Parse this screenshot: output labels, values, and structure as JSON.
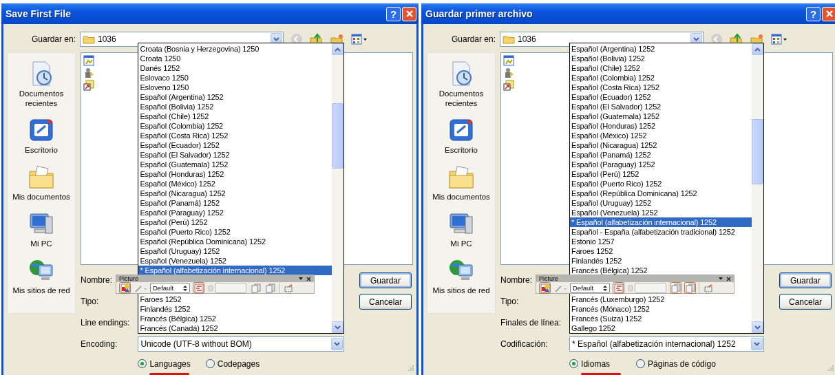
{
  "dialogs": [
    {
      "title": "Save First File",
      "help_button": "?",
      "save_in": {
        "label": "Guardar en:",
        "value": "1036"
      },
      "places": [
        {
          "label": "Documentos recientes",
          "kind": "recent"
        },
        {
          "label": "Escritorio",
          "kind": "desktop"
        },
        {
          "label": "Mis documentos",
          "kind": "documents"
        },
        {
          "label": "Mi PC",
          "kind": "computer"
        },
        {
          "label": "Mis sitios de red",
          "kind": "network"
        }
      ],
      "files": [
        {
          "kind": "image"
        },
        {
          "kind": "program"
        },
        {
          "kind": "shortcut"
        }
      ],
      "fields": [
        {
          "label": "Nombre:",
          "kind": "text"
        },
        {
          "label": "Tipo:",
          "kind": "text"
        },
        {
          "label": "Line endings:",
          "kind": "none"
        },
        {
          "label": "Encoding:",
          "kind": "combo",
          "value": "Unicode (UTF-8 without BOM)"
        }
      ],
      "dropdown": {
        "items_above": [
          {
            "text": "Croata (Bosnia y Herzegovina) 1250",
            "selected": false
          },
          {
            "text": "Croata 1250",
            "selected": false
          },
          {
            "text": "Danés 1252",
            "selected": false
          },
          {
            "text": "Eslovaco 1250",
            "selected": false
          },
          {
            "text": "Esloveno 1250",
            "selected": false
          },
          {
            "text": "Español (Argentina) 1252",
            "selected": false
          },
          {
            "text": "Español (Bolivia) 1252",
            "selected": false
          },
          {
            "text": "Español (Chile) 1252",
            "selected": false
          },
          {
            "text": "Español (Colombia) 1252",
            "selected": false
          },
          {
            "text": "Español (Costa Rica) 1252",
            "selected": false
          },
          {
            "text": "Español (Ecuador) 1252",
            "selected": false
          },
          {
            "text": "Español (El Salvador) 1252",
            "selected": false
          },
          {
            "text": "Español (Guatemala) 1252",
            "selected": false
          },
          {
            "text": "Español (Honduras) 1252",
            "selected": false
          },
          {
            "text": "Español (México) 1252",
            "selected": false
          },
          {
            "text": "Español (Nicaragua) 1252",
            "selected": false
          },
          {
            "text": "Español (Panamá) 1252",
            "selected": false
          },
          {
            "text": "Español (Paraguay) 1252",
            "selected": false
          },
          {
            "text": "Español (Perú) 1252",
            "selected": false
          },
          {
            "text": "Español (Puerto Rico) 1252",
            "selected": false
          },
          {
            "text": "Español (República Dominicana) 1252",
            "selected": false
          },
          {
            "text": "Español (Uruguay) 1252",
            "selected": false
          },
          {
            "text": "Español (Venezuela) 1252",
            "selected": false
          },
          {
            "text": "* Español (alfabetización internacional) 1252",
            "selected": true
          }
        ],
        "items_below": [
          {
            "text": "Faroes 1252",
            "selected": false
          },
          {
            "text": "Finlandés 1252",
            "selected": false
          },
          {
            "text": "Francés (Bélgica) 1252",
            "selected": false
          },
          {
            "text": "Francés (Canadá) 1252",
            "selected": false
          }
        ]
      },
      "buttons": [
        {
          "label": "Guardar",
          "default": true
        },
        {
          "label": "Cancelar",
          "default": false
        }
      ],
      "radios": [
        {
          "label": "Languages",
          "selected": true,
          "underlined": true
        },
        {
          "label": "Codepages",
          "selected": false,
          "underlined": false
        }
      ],
      "picture_toolbar": {
        "title": "Picture",
        "tools": [
          {
            "kind": "image",
            "on": true
          },
          {
            "kind": "brush",
            "on": false
          },
          {
            "kind": "select",
            "value": "Default"
          },
          {
            "kind": "filter",
            "on": true
          },
          {
            "kind": "spin",
            "on": false
          },
          {
            "kind": "copy",
            "on": false
          },
          {
            "kind": "copy",
            "on": false
          },
          {
            "kind": "separator"
          },
          {
            "kind": "crop",
            "on": false
          }
        ]
      }
    },
    {
      "title": "Guardar primer archivo",
      "help_button": "?",
      "save_in": {
        "label": "Guardar en:",
        "value": "1036"
      },
      "places": [
        {
          "label": "Documentos recientes",
          "kind": "recent"
        },
        {
          "label": "Escritorio",
          "kind": "desktop"
        },
        {
          "label": "Mis documentos",
          "kind": "documents"
        },
        {
          "label": "Mi PC",
          "kind": "computer"
        },
        {
          "label": "Mis sitios de red",
          "kind": "network"
        }
      ],
      "files": [
        {
          "kind": "image"
        },
        {
          "kind": "program"
        },
        {
          "kind": "shortcut"
        }
      ],
      "fields": [
        {
          "label": "Nombre:",
          "kind": "text"
        },
        {
          "label": "Tipo:",
          "kind": "text"
        },
        {
          "label": "Finales de línea:",
          "kind": "none"
        },
        {
          "label": "Codificación:",
          "kind": "combo",
          "value": "* Español (alfabetización internacional) 1252"
        }
      ],
      "dropdown": {
        "items_above": [
          {
            "text": "Español (Argentina) 1252",
            "selected": false
          },
          {
            "text": "Español (Bolivia) 1252",
            "selected": false
          },
          {
            "text": "Español (Chile) 1252",
            "selected": false
          },
          {
            "text": "Español (Colombia) 1252",
            "selected": false
          },
          {
            "text": "Español (Costa Rica) 1252",
            "selected": false
          },
          {
            "text": "Español (Ecuador) 1252",
            "selected": false
          },
          {
            "text": "Español (El Salvador) 1252",
            "selected": false
          },
          {
            "text": "Español (Guatemala) 1252",
            "selected": false
          },
          {
            "text": "Español (Honduras) 1252",
            "selected": false
          },
          {
            "text": "Español (México) 1252",
            "selected": false
          },
          {
            "text": "Español (Nicaragua) 1252",
            "selected": false
          },
          {
            "text": "Español (Panamá) 1252",
            "selected": false
          },
          {
            "text": "Español (Paraguay) 1252",
            "selected": false
          },
          {
            "text": "Español (Perú) 1252",
            "selected": false
          },
          {
            "text": "Español (Puerto Rico) 1252",
            "selected": false
          },
          {
            "text": "Español (República Dominicana) 1252",
            "selected": false
          },
          {
            "text": "Español (Uruguay) 1252",
            "selected": false
          },
          {
            "text": "Español (Venezuela) 1252",
            "selected": false
          },
          {
            "text": "* Español (alfabetización internacional) 1252",
            "selected": true
          },
          {
            "text": "Español - España (alfabetización tradicional) 1252",
            "selected": false
          },
          {
            "text": "Estonio 1257",
            "selected": false
          },
          {
            "text": "Faroes 1252",
            "selected": false
          },
          {
            "text": "Finlandés 1252",
            "selected": false
          },
          {
            "text": "Francés (Bélgica) 1252",
            "selected": false
          }
        ],
        "items_below": [
          {
            "text": "Francés (Luxemburgo) 1252",
            "selected": false
          },
          {
            "text": "Francés (Mónaco) 1252",
            "selected": false
          },
          {
            "text": "Francés (Suiza) 1252",
            "selected": false
          },
          {
            "text": "Gallego 1252",
            "selected": false
          }
        ]
      },
      "buttons": [
        {
          "label": "Guardar",
          "default": true
        },
        {
          "label": "Cancelar",
          "default": false
        }
      ],
      "radios": [
        {
          "label": "Idiomas",
          "selected": true,
          "underlined": true
        },
        {
          "label": "Páginas de código",
          "selected": false,
          "underlined": false
        }
      ],
      "picture_toolbar": {
        "title": "Picture",
        "tools": [
          {
            "kind": "image",
            "on": true
          },
          {
            "kind": "brush",
            "on": false
          },
          {
            "kind": "select",
            "value": "Default"
          },
          {
            "kind": "filter",
            "on": true
          },
          {
            "kind": "spin",
            "on": false
          },
          {
            "kind": "copy",
            "on": true
          },
          {
            "kind": "copy",
            "on": true
          },
          {
            "kind": "separator"
          },
          {
            "kind": "crop",
            "on": false
          }
        ]
      }
    }
  ]
}
